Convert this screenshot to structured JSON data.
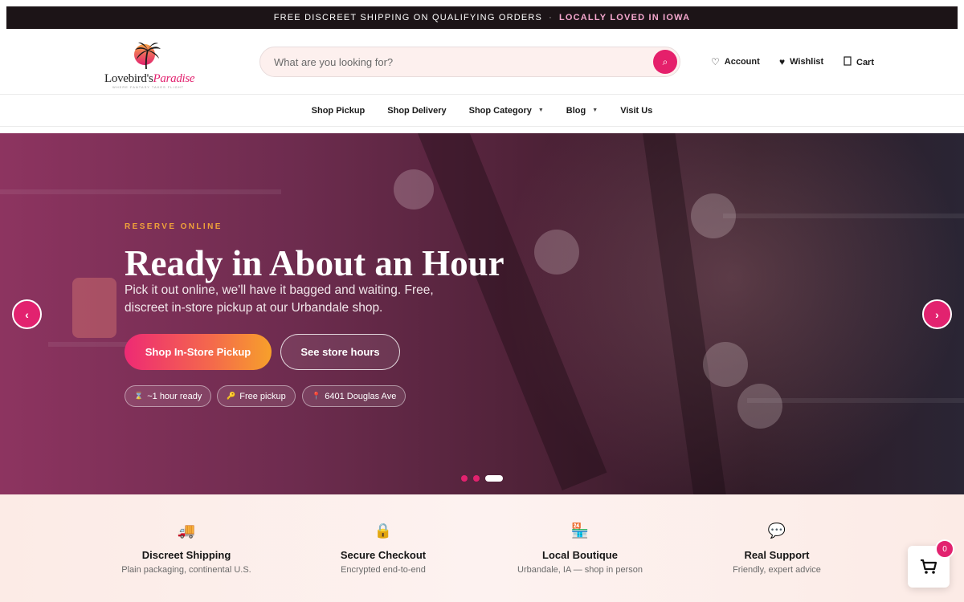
{
  "announcement": {
    "text": "FREE DISCREET SHIPPING ON QUALIFYING ORDERS",
    "separator": "·",
    "highlight": "LOCALLY LOVED IN IOWA"
  },
  "header": {
    "logo": {
      "part1": "Lovebird's",
      "part2": "Paradise",
      "tagline": "WHERE FANTASY TAKES FLIGHT"
    },
    "search": {
      "placeholder": "What are you looking for?",
      "value": ""
    },
    "links": [
      {
        "label": "Account",
        "icon": "heart-outline-icon"
      },
      {
        "label": "Wishlist",
        "icon": "heart-icon"
      },
      {
        "label": "Cart",
        "icon": "cart-outline-icon"
      }
    ]
  },
  "nav": {
    "items": [
      {
        "label": "Shop Pickup",
        "dropdown": false
      },
      {
        "label": "Shop Delivery",
        "dropdown": false
      },
      {
        "label": "Shop Category",
        "dropdown": true
      },
      {
        "label": "Blog",
        "dropdown": true
      },
      {
        "label": "Visit Us",
        "dropdown": false
      }
    ]
  },
  "hero": {
    "eyebrow": "RESERVE ONLINE",
    "title": "Ready in About an Hour",
    "subtitle": "Pick it out online, we'll have it bagged and waiting. Free, discreet in-store pickup at our Urbandale shop.",
    "primary_button": "Shop In-Store Pickup",
    "secondary_button": "See store hours",
    "pills": [
      {
        "icon": "hourglass-icon",
        "text": "~1 hour ready"
      },
      {
        "icon": "key-icon",
        "text": "Free pickup"
      },
      {
        "icon": "pin-icon",
        "text": "6401 Douglas Ave"
      }
    ],
    "carousel": {
      "slides": 3,
      "active": 3
    },
    "prev_arrow": "‹",
    "next_arrow": "›"
  },
  "features": [
    {
      "icon": "delivery-truck-icon",
      "title": "Discreet Shipping",
      "subtitle": "Plain packaging, continental U.S."
    },
    {
      "icon": "lock-icon",
      "title": "Secure Checkout",
      "subtitle": "Encrypted end-to-end"
    },
    {
      "icon": "storefront-icon",
      "title": "Local Boutique",
      "subtitle": "Urbandale, IA — shop in person"
    },
    {
      "icon": "speech-bubble-icon",
      "title": "Real Support",
      "subtitle": "Friendly, expert advice"
    }
  ],
  "floating_cart": {
    "count": "0"
  },
  "colors": {
    "brand_pink": "#e2226f",
    "announce_bg": "#1c1417",
    "eyebrow_orange": "#f0a23a",
    "feature_bg": "#fcebe6"
  }
}
